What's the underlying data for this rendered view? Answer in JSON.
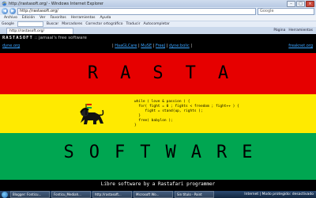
{
  "window": {
    "title": "http://rastasoft.org/ - Windows Internet Explorer",
    "address": "http://rastasoft.org/",
    "search_placeholder": "Google",
    "tab_label": "http://rastasoft.org/"
  },
  "menu": [
    "Archivo",
    "Edición",
    "Ver",
    "Favoritos",
    "Herramientas",
    "Ayuda"
  ],
  "links_bar": {
    "left": [
      "Google"
    ],
    "search_value": "",
    "items": [
      "Buscar",
      "Marcadores",
      "Corrector ortográfico",
      "Traducir",
      "Autocompletar"
    ],
    "right": [
      "Página",
      "Herramientas"
    ]
  },
  "page": {
    "brand": "RASTASOFT",
    "brand_tagline": ":: jamaal's free software",
    "left_link": "dyne.org",
    "center_prefix": "| ",
    "center_links": [
      "HaaGLCare",
      "MuSE",
      "FreeJ",
      "dyne:bolic"
    ],
    "right_link": "freaknet.org",
    "word_top": "RASTA",
    "word_bottom": "SOFTWARE",
    "code_lines": [
      "while ( love & passion ) {",
      "  for( fight = 0 ; fights < freedom ; fight++ ) {",
      "     fight = stand(up, rights );",
      "  }",
      "  free( babylon );",
      "}"
    ],
    "footer": "Libre software by a Rastafari programmer"
  },
  "taskbar": {
    "items": [
      "Blogger: Fonticu...",
      "Fonticu_Mediah...",
      "http://rastasoft...",
      "Microsoft Wo...",
      "Sin título - Paint"
    ],
    "tray": "Internet | Modo protegido: desactivado"
  },
  "colors": {
    "red": "#e60000",
    "yellow": "#ffea00",
    "green": "#00a651",
    "link": "#39a3ff"
  }
}
